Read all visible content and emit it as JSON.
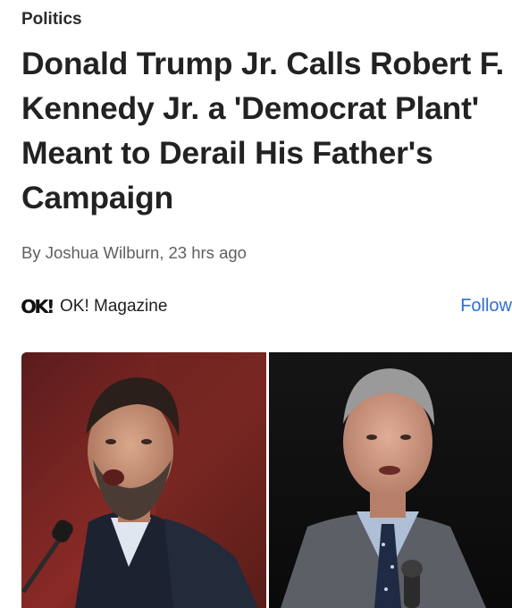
{
  "article": {
    "category": "Politics",
    "headline": "Donald Trump Jr. Calls Robert F. Kennedy Jr. a 'Democrat Plant' Meant to Derail His Father's Campaign",
    "byline": "By Joshua Wilburn, 23 hrs ago"
  },
  "source": {
    "logo_text": "OK!",
    "name": "OK! Magazine",
    "follow_label": "Follow"
  },
  "hero_image": {
    "left_subject": "man speaking at microphone",
    "right_subject": "man in suit and tie"
  }
}
